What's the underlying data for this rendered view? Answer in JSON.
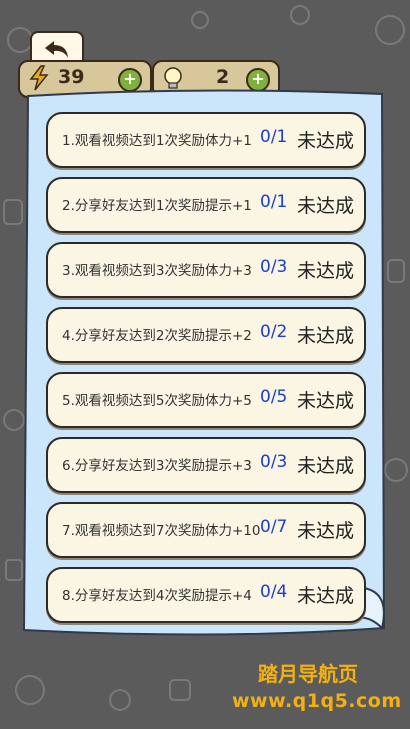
{
  "stats": {
    "energy_value": "39",
    "hint_value": "2"
  },
  "tasks": [
    {
      "label": "1.观看视频达到1次奖励体力+1",
      "progress": "0/1",
      "status": "未达成"
    },
    {
      "label": "2.分享好友达到1次奖励提示+1",
      "progress": "0/1",
      "status": "未达成"
    },
    {
      "label": "3.观看视频达到3次奖励体力+3",
      "progress": "0/3",
      "status": "未达成"
    },
    {
      "label": "4.分享好友达到2次奖励提示+2",
      "progress": "0/2",
      "status": "未达成"
    },
    {
      "label": "5.观看视频达到5次奖励体力+5",
      "progress": "0/5",
      "status": "未达成"
    },
    {
      "label": "6.分享好友达到3次奖励提示+3",
      "progress": "0/3",
      "status": "未达成"
    },
    {
      "label": "7.观看视频达到7次奖励体力+10",
      "progress": "0/7",
      "status": "未达成"
    },
    {
      "label": "8.分享好友达到4次奖励提示+4",
      "progress": "0/4",
      "status": "未达成"
    }
  ],
  "watermark": {
    "line1": "踏月导航页",
    "line2": "www.q1q5.com"
  },
  "colors": {
    "background": "#5b5b5b",
    "panel": "#cbe6fb",
    "card": "#fbf6e3",
    "progress_text": "#1d3fc4",
    "watermark": "#f3b012"
  }
}
